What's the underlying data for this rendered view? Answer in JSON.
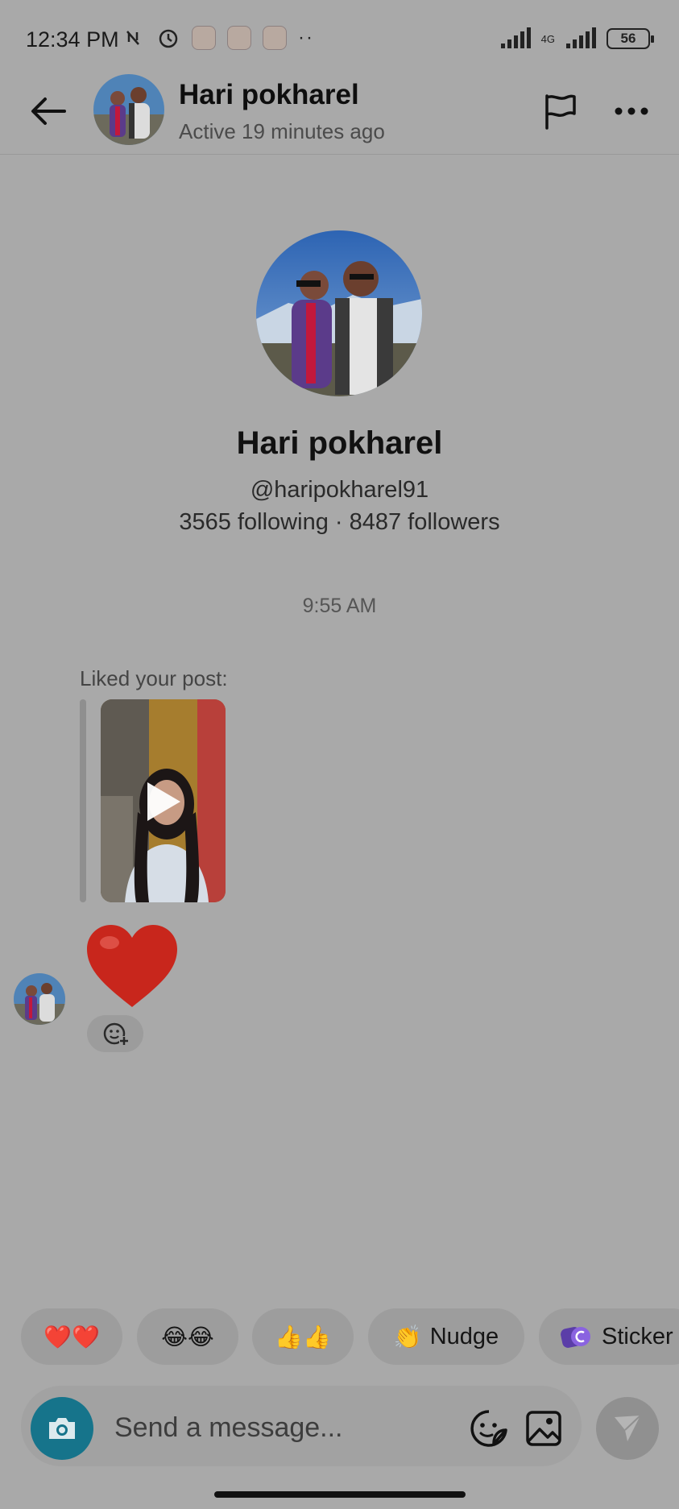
{
  "status_bar": {
    "time": "12:34 PM",
    "network": "4G",
    "battery": "56"
  },
  "header": {
    "name": "Hari pokharel",
    "status": "Active 19 minutes ago"
  },
  "profile": {
    "name": "Hari pokharel",
    "handle": "@haripokharel91",
    "stats": "3565 following · 8487 followers"
  },
  "conversation": {
    "timestamp": "9:55 AM",
    "liked_label": "Liked your post:",
    "reaction_emoji": "❤️"
  },
  "quick_replies": [
    {
      "emoji": "❤️❤️",
      "label": ""
    },
    {
      "emoji": "😂😂",
      "label": ""
    },
    {
      "emoji": "👍👍",
      "label": ""
    },
    {
      "emoji": "👏",
      "label": "Nudge"
    },
    {
      "emoji": "",
      "label": "Sticker"
    }
  ],
  "composer": {
    "placeholder": "Send a message..."
  },
  "colors": {
    "background": "#a9a9a9",
    "camera_button": "#16748b",
    "heart": "#d6281e"
  }
}
